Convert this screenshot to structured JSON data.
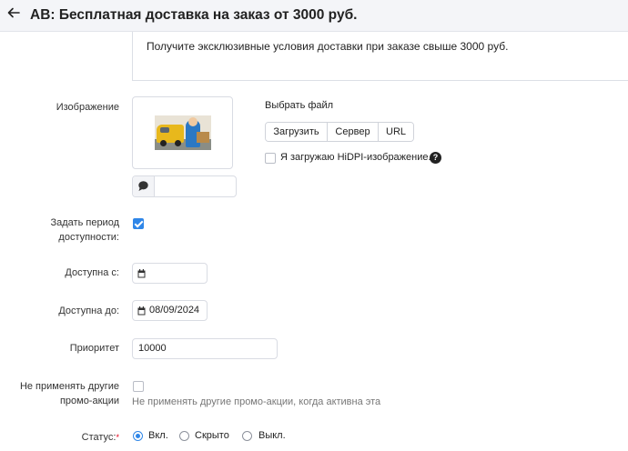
{
  "header": {
    "title": "АВ: Бесплатная доставка на заказ от 3000 руб."
  },
  "description": "Получите эксклюзивные условия доставки при заказе свыше 3000 руб.",
  "image": {
    "label": "Изображение",
    "choose_file_label": "Выбрать файл",
    "buttons": {
      "upload": "Загрузить",
      "server": "Сервер",
      "url": "URL"
    },
    "hidpi_label": "Я загружаю HiDPI-изображение.",
    "hidpi_checked": false,
    "alt_value": ""
  },
  "availability": {
    "label_line1": "Задать период",
    "label_line2": "доступности:",
    "checked": true,
    "from_label": "Доступна с:",
    "from_value": "",
    "to_label": "Доступна до:",
    "to_value": "08/09/2024"
  },
  "priority": {
    "label": "Приоритет",
    "value": "10000"
  },
  "exclusive": {
    "label_line1": "Не применять другие",
    "label_line2": "промо-акции",
    "checked": false,
    "hint": "Не применять другие промо-акции, когда активна эта"
  },
  "status": {
    "label": "Статус:",
    "required_mark": "*",
    "options": [
      {
        "label": "Вкл.",
        "selected": true
      },
      {
        "label": "Скрыто",
        "selected": false
      },
      {
        "label": "Выкл.",
        "selected": false
      }
    ]
  },
  "colors": {
    "accent": "#2f86e8",
    "required": "#e2001a",
    "topbar_bg": "#f4f5f8"
  }
}
